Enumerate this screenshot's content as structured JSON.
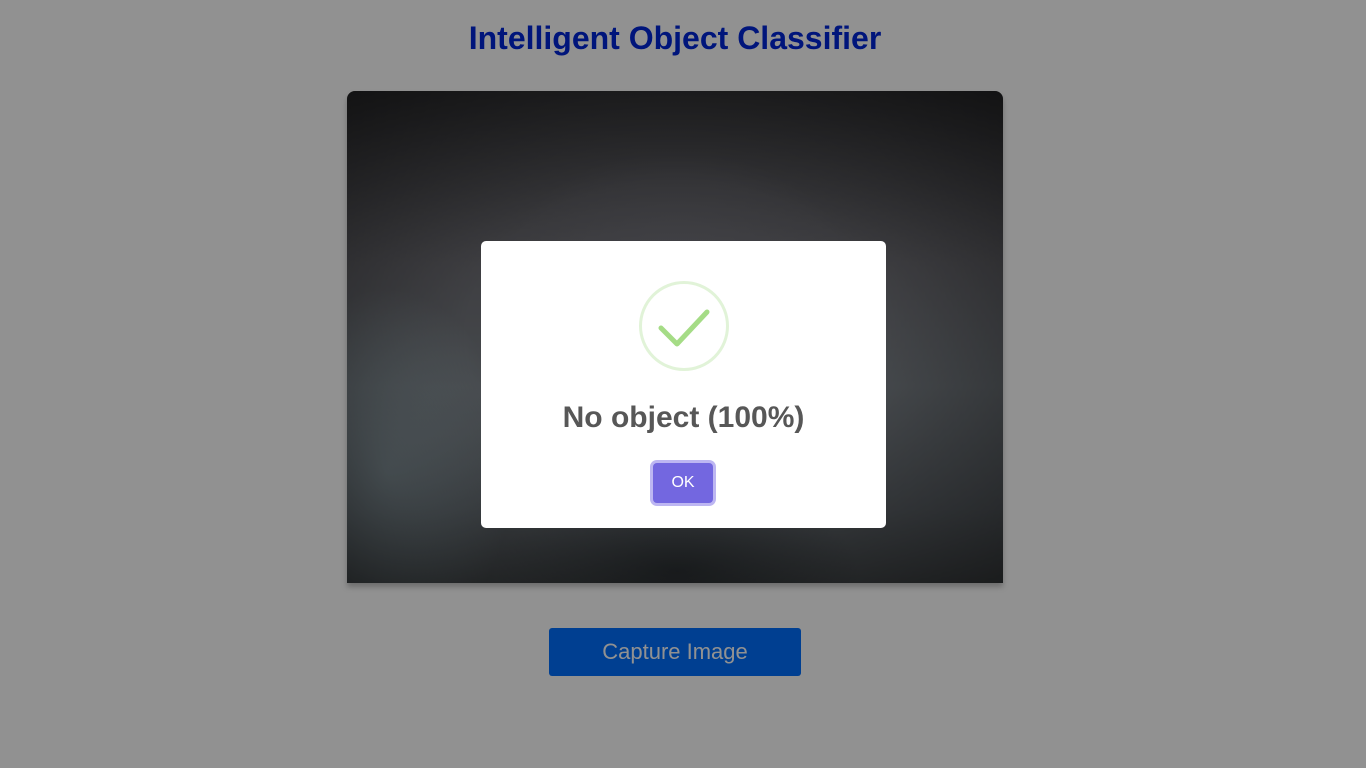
{
  "page": {
    "title": "Intelligent Object Classifier"
  },
  "camera": {
    "label": "camera-feed"
  },
  "actions": {
    "capture_label": "Capture Image"
  },
  "dialog": {
    "icon": "success-check-icon",
    "message": "No object (100%)",
    "ok_label": "OK"
  },
  "colors": {
    "title": "#0026d8",
    "capture_button": "#0070ff",
    "ok_button": "#7367e0",
    "check": "#a5dc86",
    "check_ring": "#e1f3d8"
  }
}
